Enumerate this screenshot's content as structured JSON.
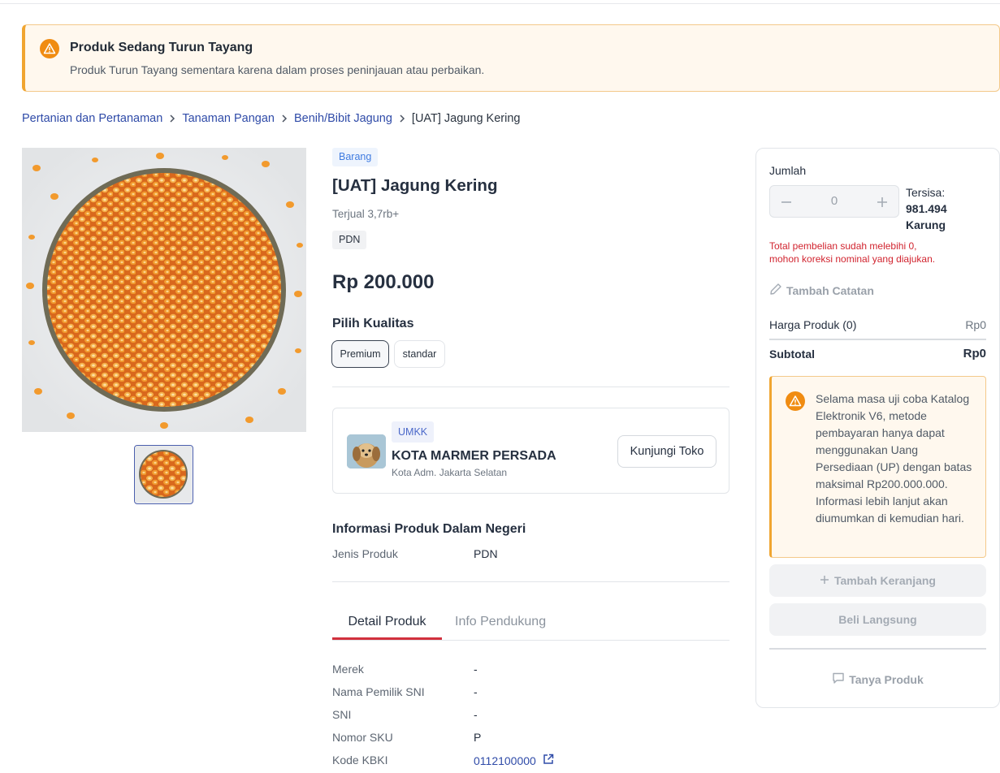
{
  "alert": {
    "title": "Produk Sedang Turun Tayang",
    "description": "Produk Turun Tayang sementara karena dalam proses peninjauan atau perbaikan.",
    "icon": "warning-icon",
    "color": "#f08c12"
  },
  "breadcrumb": [
    "Pertanian dan Pertanaman",
    "Tanaman Pangan",
    "Benih/Bibit Jagung",
    "[UAT] Jagung Kering"
  ],
  "product": {
    "type_badge": "Barang",
    "title": "[UAT] Jagung Kering",
    "sold": "Terjual 3,7rb+",
    "tag": "PDN",
    "price": "Rp 200.000",
    "quality_label": "Pilih Kualitas",
    "quality_options": [
      "Premium",
      "standar"
    ],
    "quality_selected": "Premium"
  },
  "seller": {
    "badge": "UMKK",
    "name": "KOTA MARMER PERSADA",
    "location": "Kota Adm. Jakarta Selatan",
    "visit_label": "Kunjungi Toko"
  },
  "domestic_info": {
    "title": "Informasi Produk Dalam Negeri",
    "rows": [
      {
        "label": "Jenis Produk",
        "value": "PDN"
      }
    ]
  },
  "tabs": [
    "Detail Produk",
    "Info Pendukung"
  ],
  "details": [
    {
      "label": "Merek",
      "value": "-"
    },
    {
      "label": "Nama Pemilik SNI",
      "value": "-"
    },
    {
      "label": "SNI",
      "value": "-"
    },
    {
      "label": "Nomor SKU",
      "value": "P"
    },
    {
      "label": "Kode KBKI",
      "value": "0112100000"
    }
  ],
  "cart": {
    "quantity_label": "Jumlah",
    "quantity": "0",
    "stock_label": "Tersisa:",
    "stock_value": "981.494",
    "stock_unit": "Karung",
    "error_line1": "Total pembelian sudah melebihi 0,",
    "error_line2": "mohon koreksi nominal yang diajukan.",
    "note_label": "Tambah Catatan",
    "price_label": "Harga Produk (0)",
    "price_value": "Rp0",
    "subtotal_label": "Subtotal",
    "subtotal_value": "Rp0",
    "warning": "Selama masa uji coba Katalog Elektronik V6, metode pembayaran hanya dapat menggunakan Uang Persediaan (UP) dengan batas maksimal Rp200.000.000. Informasi lebih lanjut akan diumumkan di kemudian hari.",
    "add_cart_label": "Tambah Keranjang",
    "buy_label": "Beli Langsung",
    "ask_label": "Tanya Produk"
  },
  "colors": {
    "link": "#2f4ba8",
    "accent_red": "#d2303d",
    "warning_orange": "#f08c12",
    "error_red": "#d1242f"
  }
}
